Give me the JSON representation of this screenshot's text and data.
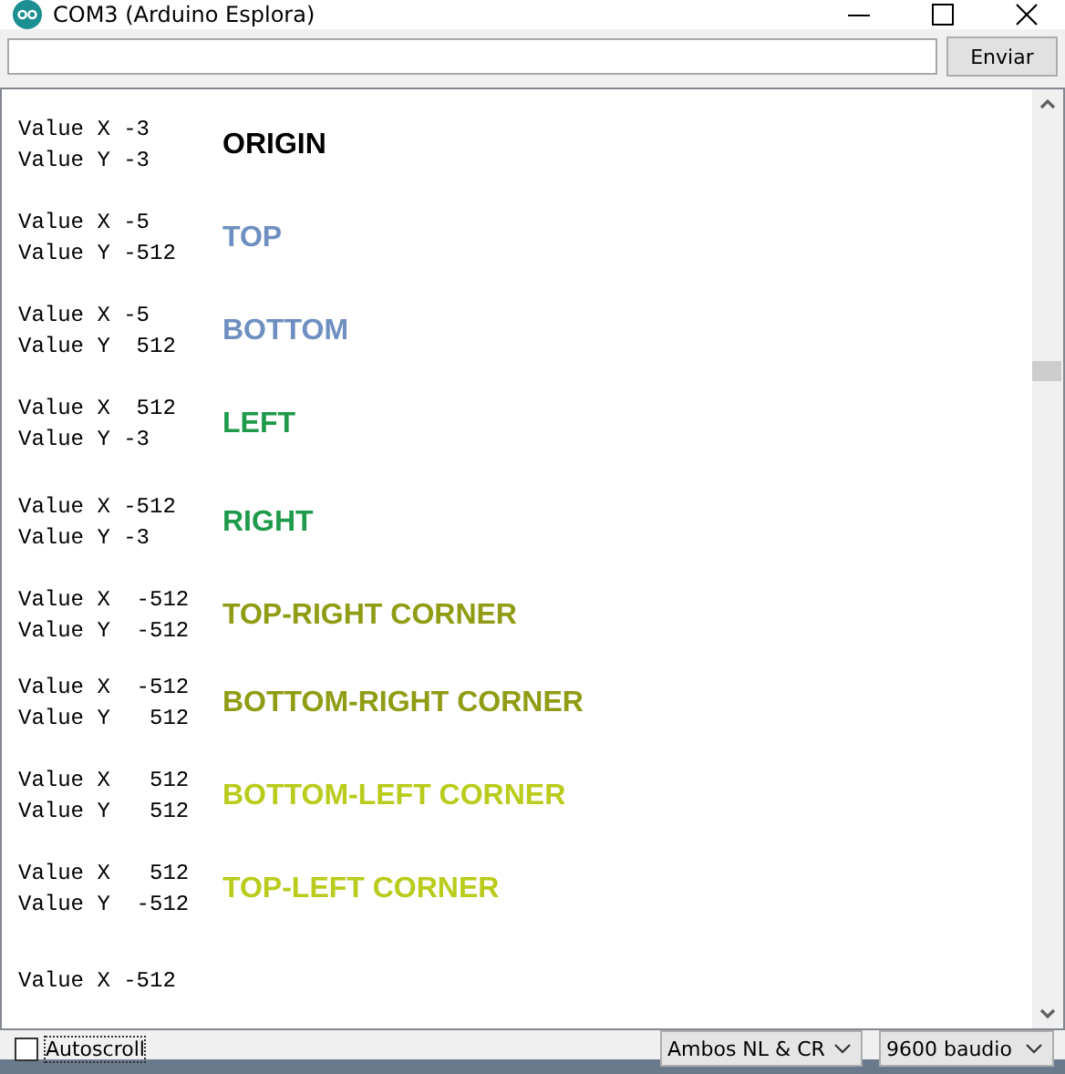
{
  "window": {
    "title": "COM3 (Arduino Esplora)"
  },
  "send_bar": {
    "button": "Enviar"
  },
  "output": [
    {
      "lines": [
        "Value X -3",
        "Value Y -3"
      ],
      "label": "ORIGIN",
      "color": "#000000"
    },
    {
      "lines": [
        "Value X -5",
        "Value Y -512"
      ],
      "label": "TOP",
      "color": "#6e8fc0"
    },
    {
      "lines": [
        "Value X -5",
        "Value Y  512"
      ],
      "label": "BOTTOM",
      "color": "#6e8fc0"
    },
    {
      "lines": [
        "Value X  512",
        "Value Y -3"
      ],
      "label": "LEFT",
      "color": "#1e9a4a"
    },
    {
      "lines": [
        "Value X -512",
        "Value Y -3"
      ],
      "label": "RIGHT",
      "color": "#1e9a4a"
    },
    {
      "lines": [
        "Value X  -512",
        "Value Y  -512"
      ],
      "label": "TOP-RIGHT CORNER",
      "color": "#8f9c14"
    },
    {
      "lines": [
        "Value X  -512",
        "Value Y   512"
      ],
      "label": "BOTTOM-RIGHT CORNER",
      "color": "#8f9c14"
    },
    {
      "lines": [
        "Value X   512",
        "Value Y   512"
      ],
      "label": "BOTTOM-LEFT CORNER",
      "color": "#b9cc1c"
    },
    {
      "lines": [
        "Value X   512",
        "Value Y  -512"
      ],
      "label": "TOP-LEFT CORNER",
      "color": "#b9cc1c"
    },
    {
      "lines": [
        "Value X -512"
      ]
    }
  ],
  "status_bar": {
    "autoscroll": {
      "label": "Autoscroll",
      "checked": false
    },
    "line_ending": "Ambos NL & CR",
    "baud_rate": "9600 baudio"
  }
}
